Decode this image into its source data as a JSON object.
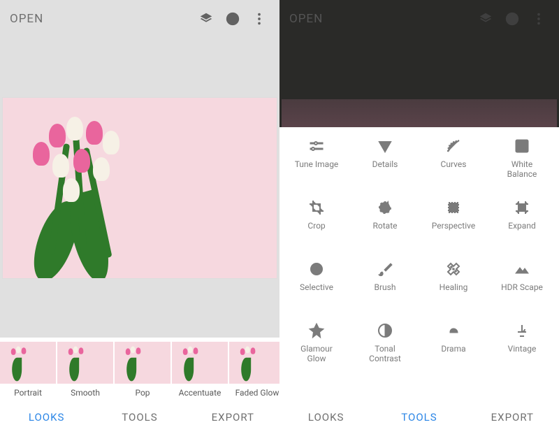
{
  "left": {
    "open": "OPEN",
    "looks": [
      "Portrait",
      "Smooth",
      "Pop",
      "Accentuate",
      "Faded Glow"
    ],
    "bottom": {
      "looks": "LOOKS",
      "tools": "TOOLS",
      "export": "EXPORT"
    }
  },
  "right": {
    "open": "OPEN",
    "tools": [
      {
        "name": "tune-image",
        "label": "Tune Image"
      },
      {
        "name": "details",
        "label": "Details"
      },
      {
        "name": "curves",
        "label": "Curves"
      },
      {
        "name": "white-balance",
        "label": "White\nBalance"
      },
      {
        "name": "crop",
        "label": "Crop"
      },
      {
        "name": "rotate",
        "label": "Rotate"
      },
      {
        "name": "perspective",
        "label": "Perspective"
      },
      {
        "name": "expand",
        "label": "Expand"
      },
      {
        "name": "selective",
        "label": "Selective"
      },
      {
        "name": "brush",
        "label": "Brush"
      },
      {
        "name": "healing",
        "label": "Healing"
      },
      {
        "name": "hdr-scape",
        "label": "HDR Scape"
      },
      {
        "name": "glamour-glow",
        "label": "Glamour\nGlow"
      },
      {
        "name": "tonal-contrast",
        "label": "Tonal\nContrast"
      },
      {
        "name": "drama",
        "label": "Drama"
      },
      {
        "name": "vintage",
        "label": "Vintage"
      }
    ],
    "bottom": {
      "looks": "LOOKS",
      "tools": "TOOLS",
      "export": "EXPORT"
    }
  }
}
